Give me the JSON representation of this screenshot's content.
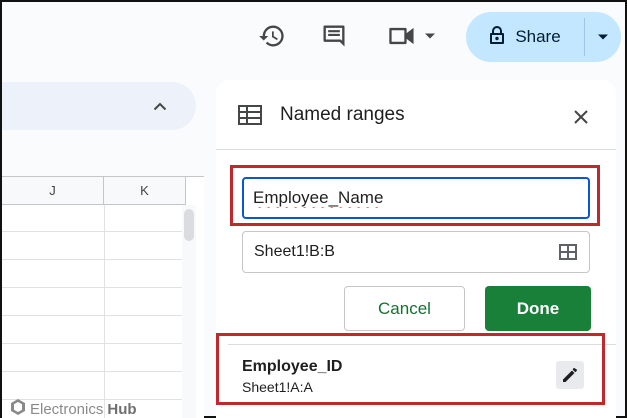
{
  "toolbar": {
    "history_icon": "history-icon",
    "comment_icon": "comment-icon",
    "meet_icon": "video-camera-icon",
    "share_label": "Share"
  },
  "sheet": {
    "columns": [
      "J",
      "K"
    ]
  },
  "panel": {
    "title": "Named ranges",
    "name_value": "Employee_Name",
    "range_value": "Sheet1!B:B",
    "cancel_label": "Cancel",
    "done_label": "Done",
    "items": [
      {
        "name": "Employee_ID",
        "range": "Sheet1!A:A"
      }
    ]
  },
  "watermark": {
    "brand": "Electronics",
    "brand_bold": "Hub"
  },
  "colors": {
    "accent_blue": "#0b57d0",
    "share_bg": "#c2e7ff",
    "done_green": "#188038",
    "highlight_red": "#c0282e"
  }
}
